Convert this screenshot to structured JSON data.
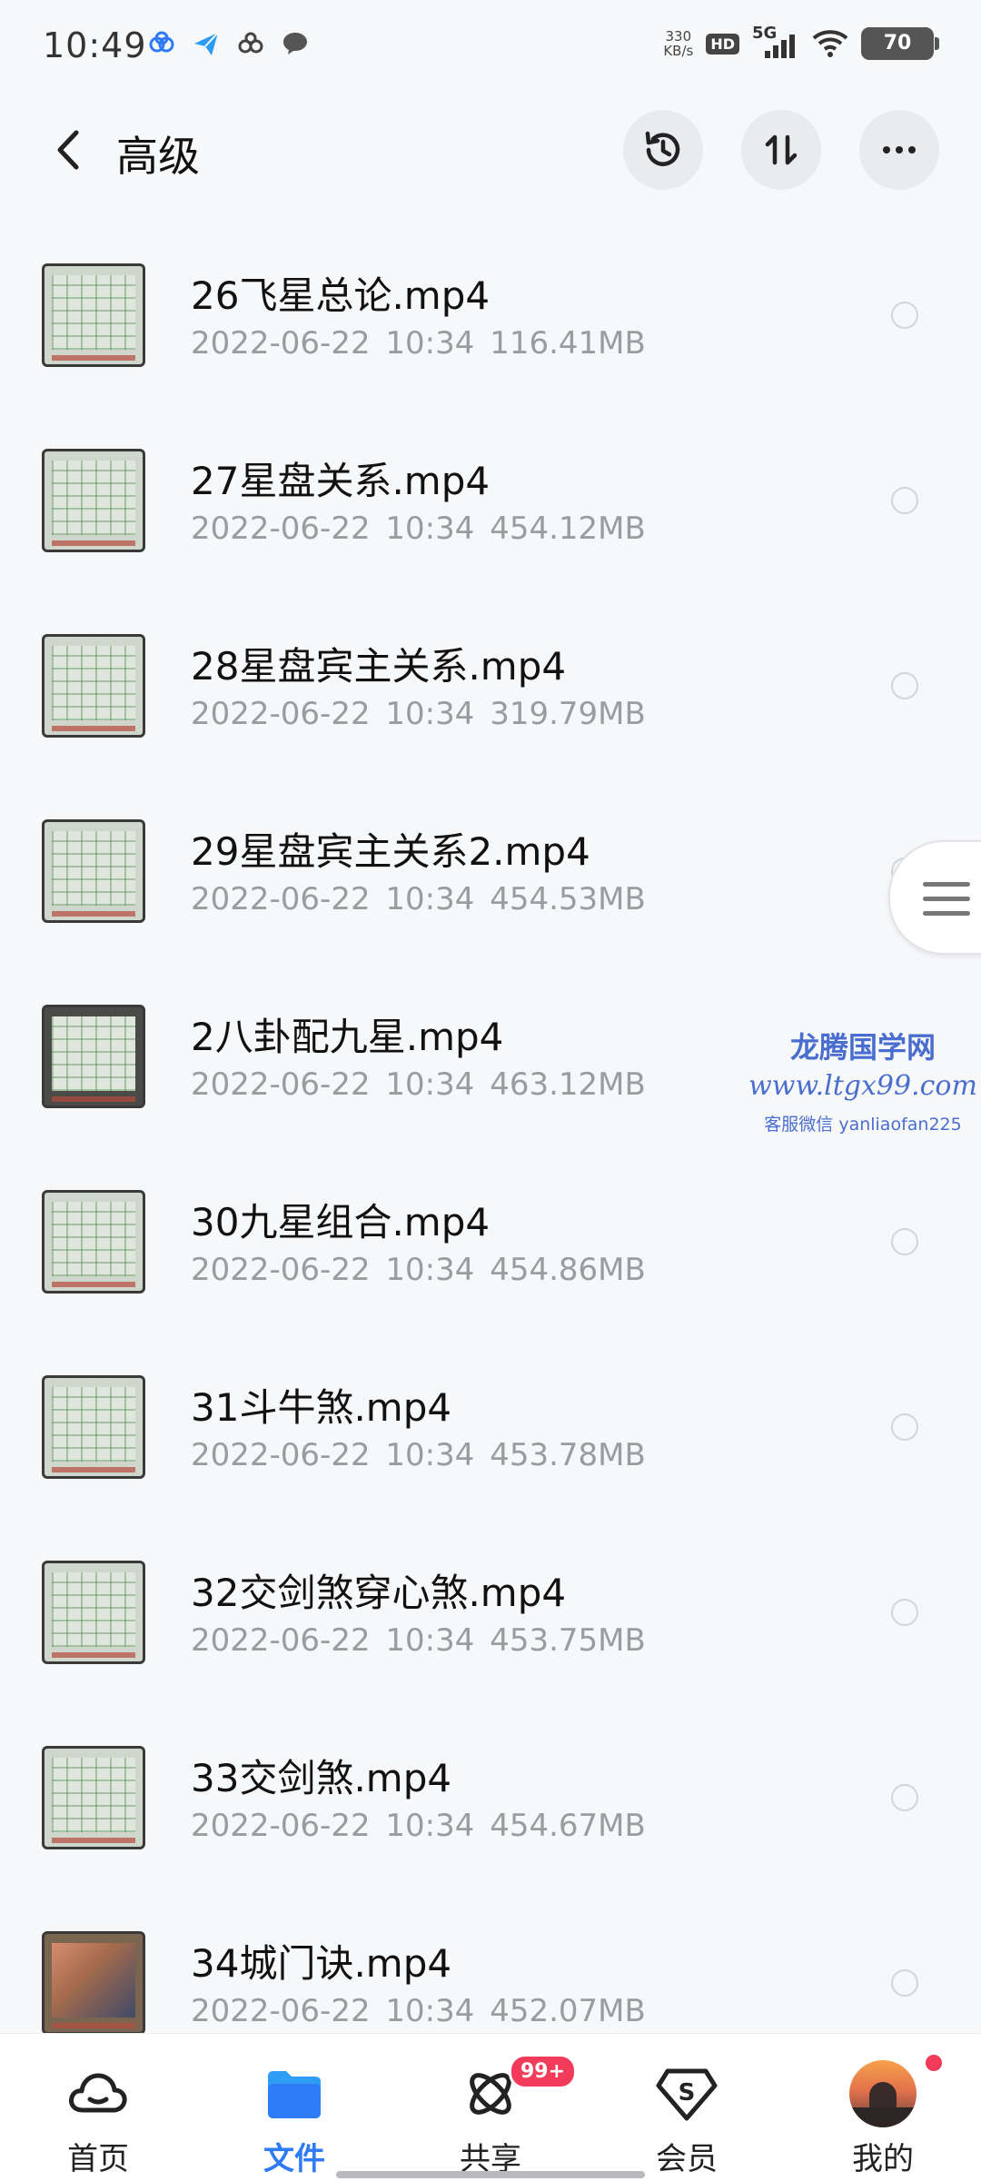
{
  "status": {
    "time": "10:49",
    "net_speed_value": "330",
    "net_speed_unit": "KB/s",
    "hd": "HD",
    "network": "5G",
    "battery": "70"
  },
  "header": {
    "title": "高级"
  },
  "files": [
    {
      "name": "26飞星总论.mp4",
      "date": "2022-06-22",
      "time": "10:34",
      "size": "116.41MB"
    },
    {
      "name": "27星盘关系.mp4",
      "date": "2022-06-22",
      "time": "10:34",
      "size": "454.12MB"
    },
    {
      "name": "28星盘宾主关系.mp4",
      "date": "2022-06-22",
      "time": "10:34",
      "size": "319.79MB"
    },
    {
      "name": "29星盘宾主关系2.mp4",
      "date": "2022-06-22",
      "time": "10:34",
      "size": "454.53MB"
    },
    {
      "name": "2八卦配九星.mp4",
      "date": "2022-06-22",
      "time": "10:34",
      "size": "463.12MB"
    },
    {
      "name": "30九星组合.mp4",
      "date": "2022-06-22",
      "time": "10:34",
      "size": "454.86MB"
    },
    {
      "name": "31斗牛煞.mp4",
      "date": "2022-06-22",
      "time": "10:34",
      "size": "453.78MB"
    },
    {
      "name": "32交剑煞穿心煞.mp4",
      "date": "2022-06-22",
      "time": "10:34",
      "size": "453.75MB"
    },
    {
      "name": "33交剑煞.mp4",
      "date": "2022-06-22",
      "time": "10:34",
      "size": "454.67MB"
    },
    {
      "name": "34城门诀.mp4",
      "date": "2022-06-22",
      "time": "10:34",
      "size": "452.07MB"
    }
  ],
  "watermark": {
    "line1": "龙腾国学网",
    "line2": "www.ltgx99.com",
    "line3": "客服微信 yanliaofan225"
  },
  "nav": {
    "home": "首页",
    "files": "文件",
    "share": "共享",
    "share_badge": "99+",
    "vip": "会员",
    "me": "我的"
  },
  "colors": {
    "accent": "#2f7bf6",
    "badge": "#f23b5a",
    "meta_text": "#9a9ca2"
  }
}
